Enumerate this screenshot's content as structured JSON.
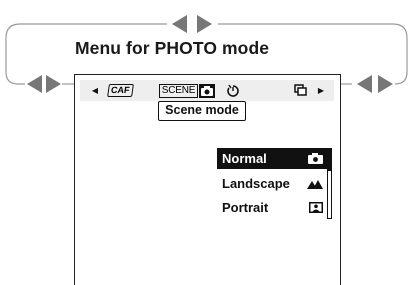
{
  "title": "Menu for PHOTO mode",
  "toolbar": {
    "caf_label": "CAF",
    "scene_label": "SCENE"
  },
  "tooltip": "Scene mode",
  "scene_menu": {
    "items": [
      {
        "label": "Normal",
        "icon": "camera-icon",
        "selected": true
      },
      {
        "label": "Landscape",
        "icon": "mountain-icon",
        "selected": false
      },
      {
        "label": "Portrait",
        "icon": "portrait-icon",
        "selected": false
      }
    ]
  },
  "colors": {
    "highlight": "#111111",
    "toolbar_bg": "#eeeeee",
    "arrow": "#777777"
  }
}
